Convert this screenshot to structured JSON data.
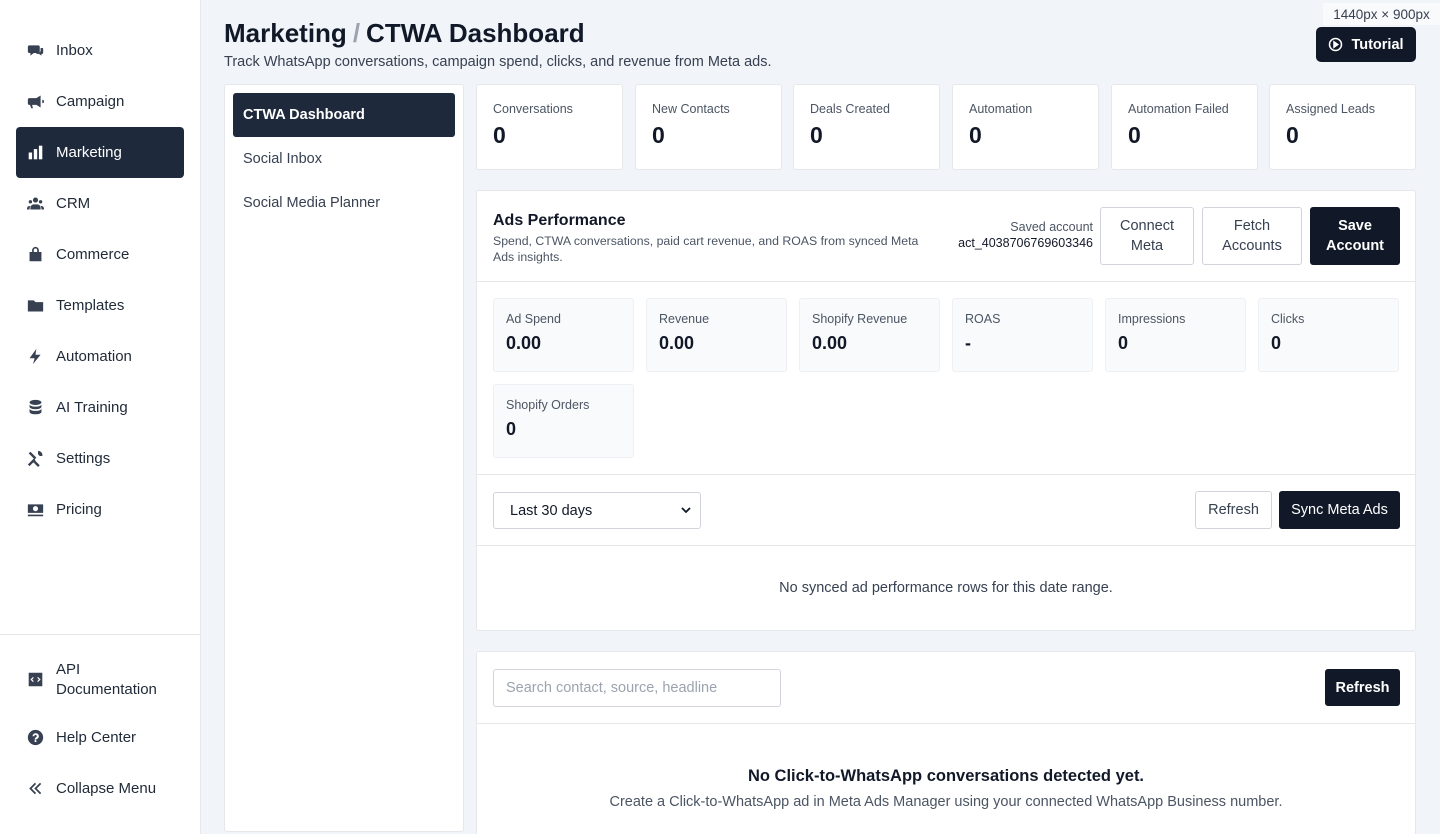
{
  "sidebar": {
    "items": [
      {
        "label": "Inbox",
        "icon": "inbox-icon"
      },
      {
        "label": "Campaign",
        "icon": "megaphone-icon"
      },
      {
        "label": "Marketing",
        "icon": "bar-chart-icon",
        "active": true
      },
      {
        "label": "CRM",
        "icon": "users-icon"
      },
      {
        "label": "Commerce",
        "icon": "shopping-bag-icon"
      },
      {
        "label": "Templates",
        "icon": "folder-icon"
      },
      {
        "label": "Automation",
        "icon": "bolt-icon"
      },
      {
        "label": "AI Training",
        "icon": "database-icon"
      },
      {
        "label": "Settings",
        "icon": "tools-icon"
      },
      {
        "label": "Pricing",
        "icon": "money-icon"
      }
    ],
    "bottom": [
      {
        "label_line1": "API",
        "label_line2": "Documentation",
        "icon": "code-icon"
      },
      {
        "label": "Help Center",
        "icon": "help-icon"
      },
      {
        "label": "Collapse Menu",
        "icon": "chevrons-left-icon"
      }
    ]
  },
  "header": {
    "breadcrumb_parent": "Marketing",
    "breadcrumb_sep": "/",
    "title": "CTWA Dashboard",
    "subtitle": "Track WhatsApp conversations, campaign spend, clicks, and revenue from Meta ads.",
    "tutorial_label": "Tutorial",
    "size_badge": "1440px × 900px"
  },
  "subnav": {
    "items": [
      {
        "label": "CTWA Dashboard",
        "active": true
      },
      {
        "label": "Social Inbox"
      },
      {
        "label": "Social Media Planner"
      }
    ]
  },
  "stats": [
    {
      "label": "Conversations",
      "value": "0"
    },
    {
      "label": "New Contacts",
      "value": "0"
    },
    {
      "label": "Deals Created",
      "value": "0"
    },
    {
      "label": "Automation",
      "value": "0"
    },
    {
      "label": "Automation Failed",
      "value": "0"
    },
    {
      "label": "Assigned Leads",
      "value": "0"
    }
  ],
  "ads": {
    "title": "Ads Performance",
    "description": "Spend, CTWA conversations, paid cart revenue, and ROAS from synced Meta Ads insights.",
    "saved_account_label": "Saved account",
    "saved_account_value": "act_4038706769603346",
    "connect_line1": "Connect",
    "connect_line2": "Meta",
    "fetch_line1": "Fetch",
    "fetch_line2": "Accounts",
    "save_line1": "Save",
    "save_line2": "Account",
    "metrics": [
      {
        "label": "Ad Spend",
        "value": "0.00"
      },
      {
        "label": "Revenue",
        "value": "0.00"
      },
      {
        "label": "Shopify Revenue",
        "value": "0.00"
      },
      {
        "label": "ROAS",
        "value": "-"
      },
      {
        "label": "Impressions",
        "value": "0"
      },
      {
        "label": "Clicks",
        "value": "0"
      },
      {
        "label": "Shopify Orders",
        "value": "0"
      }
    ],
    "date_range": "Last 30 days",
    "refresh_label": "Refresh",
    "sync_label": "Sync Meta Ads",
    "empty_message": "No synced ad performance rows for this date range."
  },
  "ctwa": {
    "search_placeholder": "Search contact, source, headline",
    "refresh_label": "Refresh",
    "empty_title": "No Click-to-WhatsApp conversations detected yet.",
    "empty_subtitle": "Create a Click-to-WhatsApp ad in Meta Ads Manager using your connected WhatsApp Business number."
  },
  "colors": {
    "active_bg": "#1e293b",
    "dark_button": "#111827",
    "page_bg": "#f1f4f8"
  }
}
